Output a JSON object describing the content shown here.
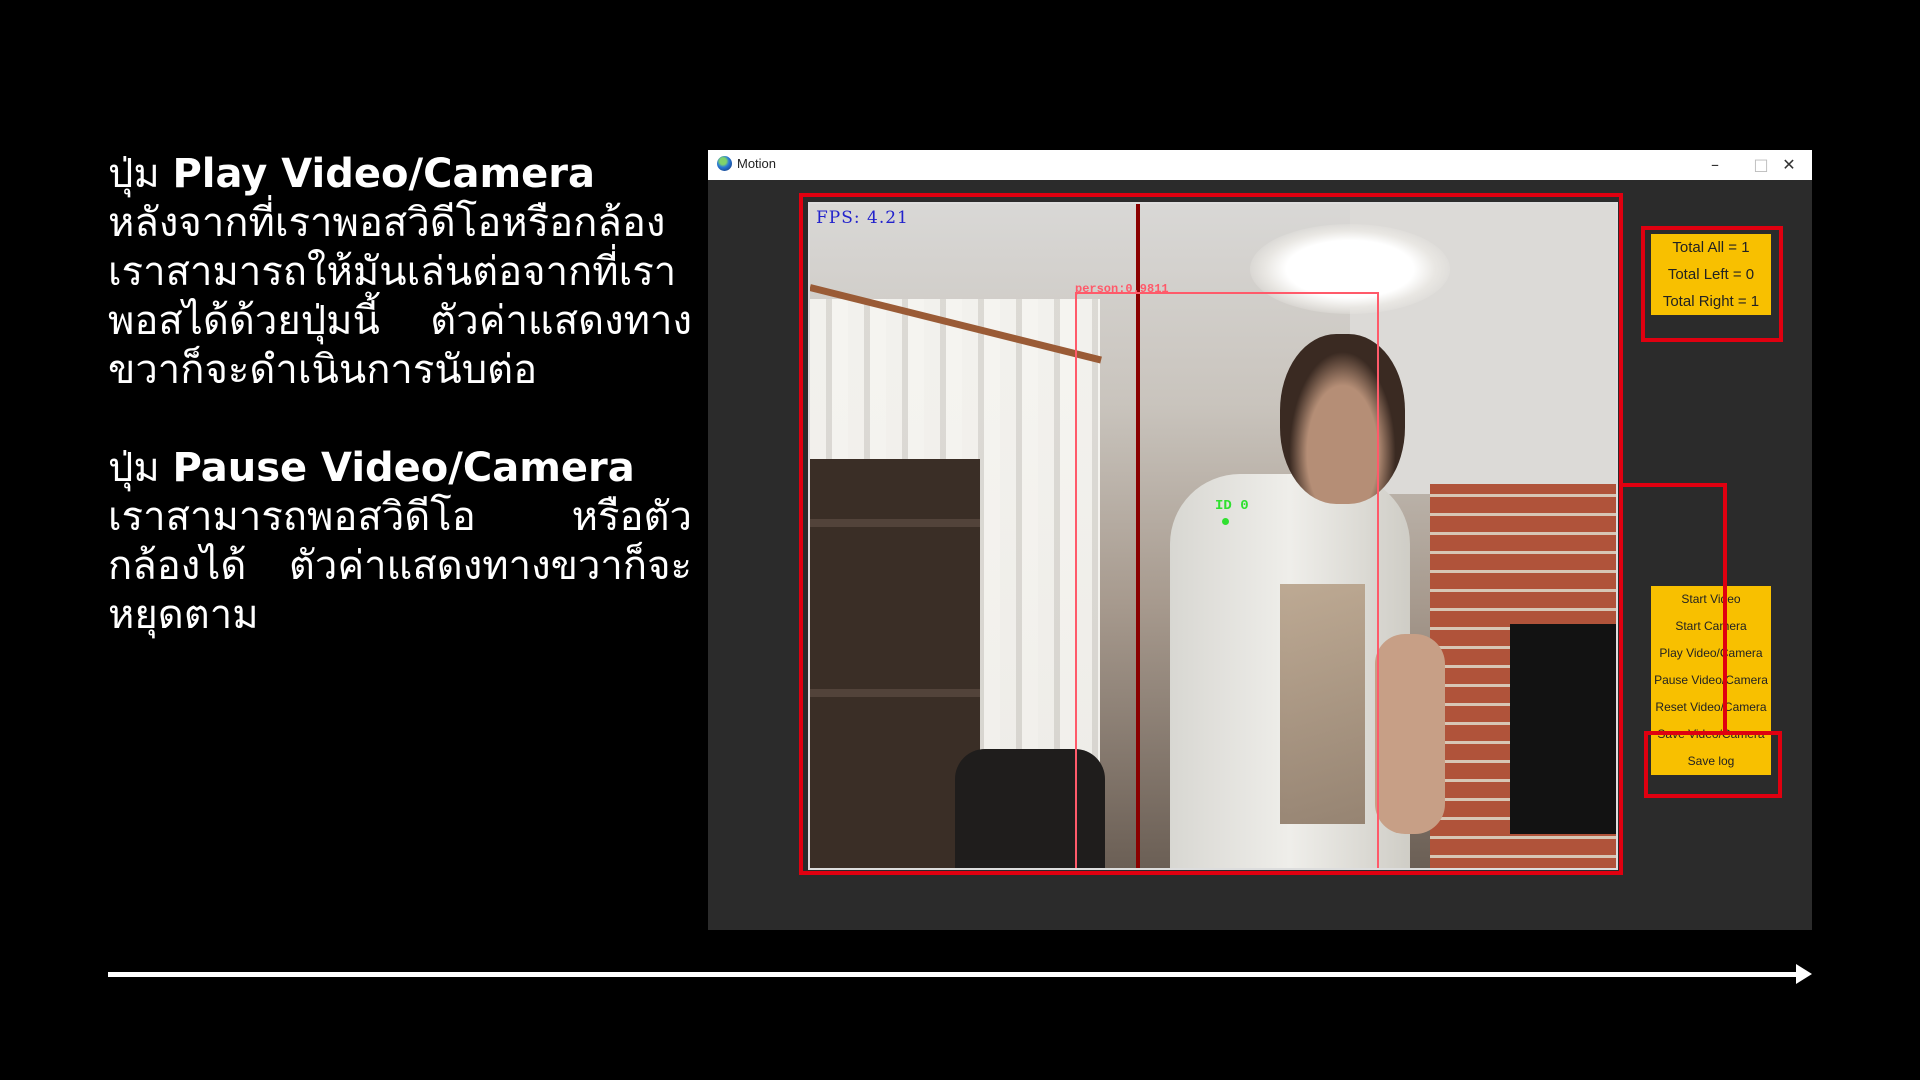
{
  "slide": {
    "block1": {
      "prefix": "ปุ่ม ",
      "button_name": "Play Video/Camera",
      "body": "หลังจากที่เราพอสวิดีโอหรือกล้อง เราสามารถให้มันเล่นต่อจากที่เรา พอสได้ด้วยปุ่มนี้ ตัวค่าแสดงทาง ขวาก็จะดำเนินการนับต่อ"
    },
    "block2": {
      "prefix": "ปุ่ม ",
      "button_name": "Pause Video/Camera",
      "body": "เราสามารถพอสวิดีโอ หรือตัว กล้องได้ ตัวค่าแสดงทางขวาก็จะ หยุดตาม"
    }
  },
  "window": {
    "title": "Motion",
    "controls": {
      "minimize": "–",
      "maximize": "□",
      "close": "✕"
    },
    "video": {
      "fps_text": "FPS: 4.21",
      "detection_label": "person:0.9811",
      "track_id": "ID 0"
    },
    "totals": {
      "all": "Total All = 1",
      "left": "Total Left = 0",
      "right": "Total Right = 1"
    },
    "buttons": {
      "start_video": "Start Video",
      "start_camera": "Start Camera",
      "play": "Play Video/Camera",
      "pause": "Pause Video/Camera",
      "reset": "Reset Video/Camera",
      "save_video": "Save Video/Camera",
      "save_log": "Save log"
    }
  },
  "colors": {
    "highlight": "#e00010",
    "button_bg": "#f8c000",
    "window_bg": "#2b2b2b",
    "fps_text": "#2222cc",
    "bbox": "#ff5a6a",
    "track": "#30e030"
  },
  "icons": [
    "app-globe-icon",
    "minimize-icon",
    "maximize-icon",
    "close-icon",
    "arrow-right-icon"
  ]
}
